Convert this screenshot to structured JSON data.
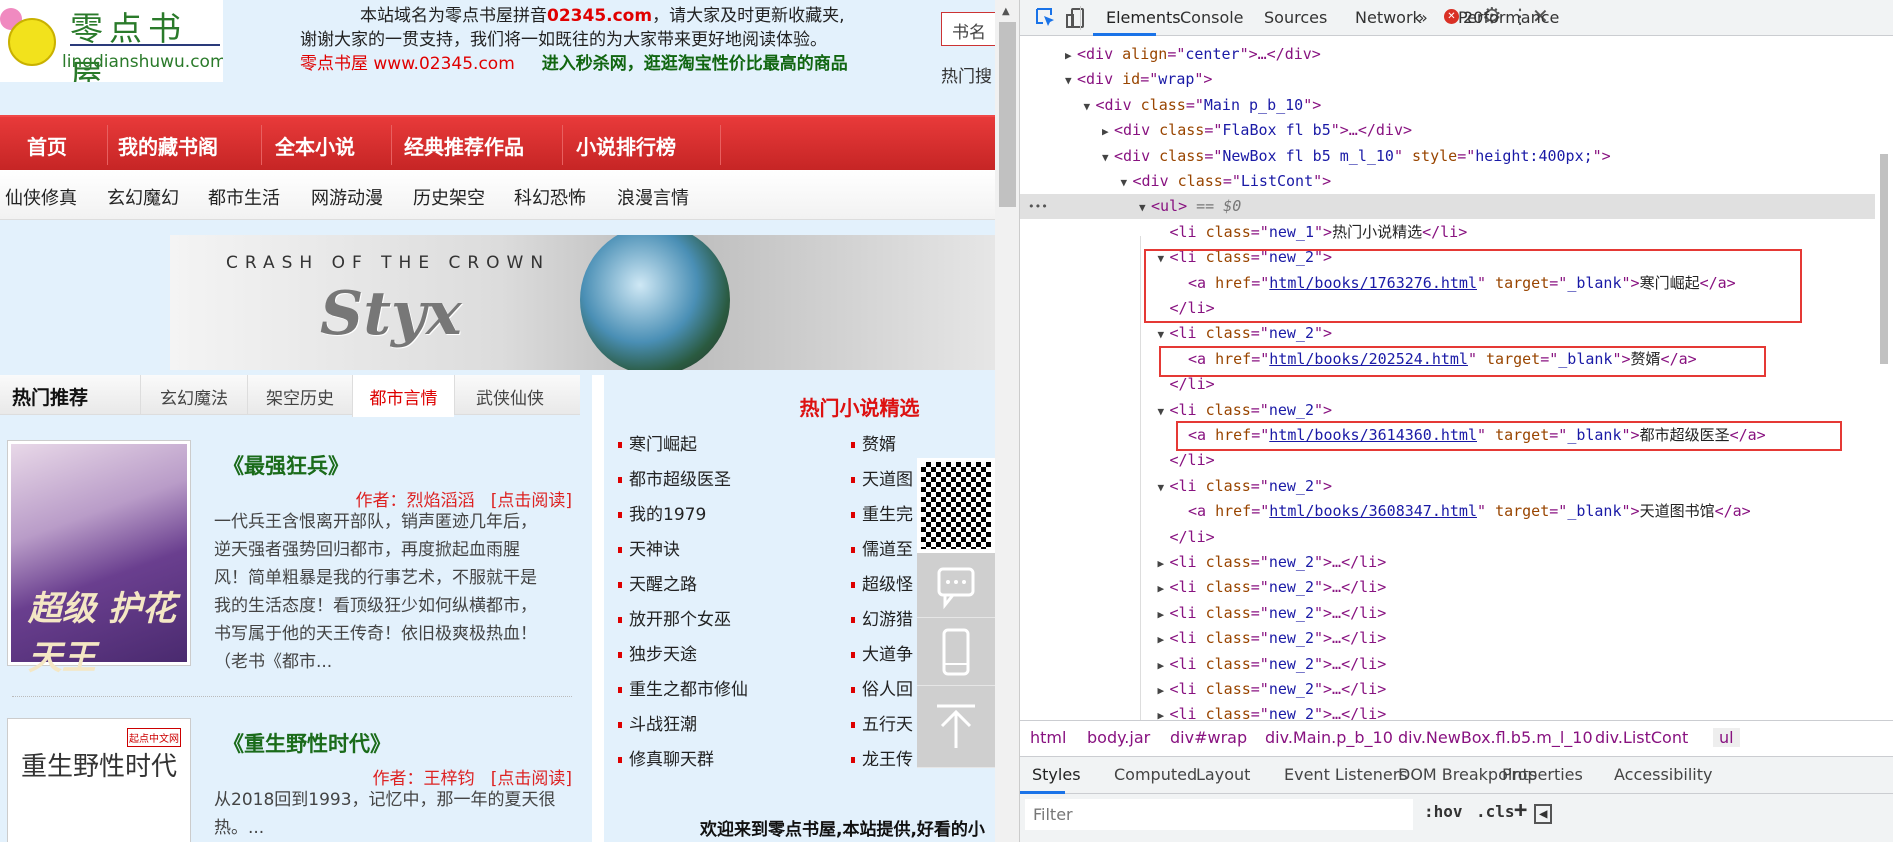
{
  "site": {
    "logo_cn": "零点书屋",
    "logo_en": "lingdianshuwu.com",
    "notice_1a": "本站域名为零点书屋拼音",
    "notice_1b": "02345.com",
    "notice_1c": "，请大家及时更新收藏夹,",
    "notice_2": "谢谢大家的一贯支持，我们将一如既往的为大家带来更好地阅读体验。",
    "notice_3a": "零点书屋 www.02345.com",
    "notice_3b": "进入秒杀网，逛逛淘宝性价比最高的商品",
    "search_placeholder": "书名",
    "hot_search": "热门搜",
    "nav": [
      "首页",
      "我的藏书阁",
      "全本小说",
      "经典推荐作品",
      "小说排行榜"
    ],
    "subnav": [
      "仙侠修真",
      "玄幻魔幻",
      "都市生活",
      "网游动漫",
      "历史架空",
      "科幻恐怖",
      "浪漫言情"
    ],
    "banner_line1": "CRASH OF THE CROWN",
    "banner_line2": "Styx",
    "tabs_head": "热门推荐",
    "tabs": [
      "玄幻魔法",
      "架空历史",
      "都市言情",
      "武侠仙侠"
    ],
    "active_tab": "都市言情",
    "books": [
      {
        "title": "《最强狂兵》",
        "author": "作者：烈焰滔滔",
        "read": "[点击阅读]",
        "cover_text": "超级 护花天王",
        "desc": [
          "一代兵王含恨离开部队，销声匿迹几年后，",
          "逆天强者强势回归都市，再度掀起血雨腥",
          "风！简单粗暴是我的行事艺术，不服就干是",
          "我的生活态度！看顶级狂少如何纵横都市，",
          "书写属于他的天王传奇！依旧极爽极热血！",
          "（老书《都市..."
        ]
      },
      {
        "title": "《重生野性时代》",
        "author": "作者：王梓钧",
        "read": "[点击阅读]",
        "cover_text": "重生野性时代",
        "cover_badge": "起点中文网",
        "desc": [
          "从2018回到1993，记忆中，那一年的夏天很",
          "热。..."
        ]
      }
    ],
    "hot_title": "热门小说精选",
    "hot_col1": [
      "寒门崛起",
      "都市超级医圣",
      "我的1979",
      "天神诀",
      "天醒之路",
      "放开那个女巫",
      "独步天途",
      "重生之都市修仙",
      "斗战狂潮",
      "修真聊天群"
    ],
    "hot_col2": [
      "赘婿",
      "天道图",
      "重生完",
      "儒道至",
      "超级怪",
      "幻游猎",
      "大道争",
      "俗人回",
      "五行天",
      "龙王传"
    ],
    "welcome": "欢迎来到零点书屋,本站提供,好看的小",
    "float_icons": [
      "qr-code",
      "chat-icon",
      "mobile-icon",
      "back-to-top-icon"
    ]
  },
  "devtools": {
    "tabs": [
      "Elements",
      "Console",
      "Sources",
      "Network",
      "Performance"
    ],
    "active_tab": "Elements",
    "more": "»",
    "error_count": "20",
    "tree": [
      {
        "depth": 0,
        "arrow": "right",
        "parts": [
          [
            "tag",
            "<div "
          ],
          [
            "attr",
            "align"
          ],
          [
            "tag",
            "=\""
          ],
          [
            "val",
            "center"
          ],
          [
            "tag",
            "\">…</div>"
          ]
        ]
      },
      {
        "depth": 0,
        "arrow": "down",
        "parts": [
          [
            "tag",
            "<div "
          ],
          [
            "attr",
            "id"
          ],
          [
            "tag",
            "=\""
          ],
          [
            "val",
            "wrap"
          ],
          [
            "tag",
            "\">"
          ]
        ]
      },
      {
        "depth": 1,
        "arrow": "down",
        "parts": [
          [
            "tag",
            "<div "
          ],
          [
            "attr",
            "class"
          ],
          [
            "tag",
            "=\""
          ],
          [
            "val",
            "Main p_b_10"
          ],
          [
            "tag",
            "\">"
          ]
        ]
      },
      {
        "depth": 2,
        "arrow": "right",
        "parts": [
          [
            "tag",
            "<div "
          ],
          [
            "attr",
            "class"
          ],
          [
            "tag",
            "=\""
          ],
          [
            "val",
            "FlaBox fl b5"
          ],
          [
            "tag",
            "\">…</div>"
          ]
        ]
      },
      {
        "depth": 2,
        "arrow": "down",
        "parts": [
          [
            "tag",
            "<div "
          ],
          [
            "attr",
            "class"
          ],
          [
            "tag",
            "=\""
          ],
          [
            "val",
            "NewBox fl b5 m_l_10"
          ],
          [
            "tag",
            "\" "
          ],
          [
            "attr",
            "style"
          ],
          [
            "tag",
            "=\""
          ],
          [
            "val",
            "height:400px;"
          ],
          [
            "tag",
            "\">"
          ]
        ]
      },
      {
        "depth": 3,
        "arrow": "down",
        "parts": [
          [
            "tag",
            "<div "
          ],
          [
            "attr",
            "class"
          ],
          [
            "tag",
            "=\""
          ],
          [
            "val",
            "ListCont"
          ],
          [
            "tag",
            "\">"
          ]
        ]
      },
      {
        "depth": 4,
        "arrow": "down",
        "selected": true,
        "parts": [
          [
            "tag",
            "<ul>"
          ],
          [
            "eq",
            " == $0"
          ]
        ]
      },
      {
        "depth": 5,
        "arrow": "none",
        "parts": [
          [
            "tag",
            "<li "
          ],
          [
            "attr",
            "class"
          ],
          [
            "tag",
            "=\""
          ],
          [
            "val",
            "new_1"
          ],
          [
            "tag",
            "\">"
          ],
          [
            "txt",
            "热门小说精选"
          ],
          [
            "tag",
            "</li>"
          ]
        ]
      },
      {
        "depth": 5,
        "arrow": "down",
        "parts": [
          [
            "tag",
            "<li "
          ],
          [
            "attr",
            "class"
          ],
          [
            "tag",
            "=\""
          ],
          [
            "val",
            "new_2"
          ],
          [
            "tag",
            "\">"
          ]
        ]
      },
      {
        "depth": 6,
        "arrow": "none",
        "parts": [
          [
            "tag",
            "<a "
          ],
          [
            "attr",
            "href"
          ],
          [
            "tag",
            "=\""
          ],
          [
            "link",
            "html/books/1763276.html"
          ],
          [
            "tag",
            "\" "
          ],
          [
            "attr",
            "target"
          ],
          [
            "tag",
            "=\""
          ],
          [
            "val",
            "_blank"
          ],
          [
            "tag",
            "\">"
          ],
          [
            "txt",
            "寒门崛起"
          ],
          [
            "tag",
            "</a>"
          ]
        ]
      },
      {
        "depth": 5,
        "arrow": "none",
        "parts": [
          [
            "tag",
            "</li>"
          ]
        ]
      },
      {
        "depth": 5,
        "arrow": "down",
        "parts": [
          [
            "tag",
            "<li "
          ],
          [
            "attr",
            "class"
          ],
          [
            "tag",
            "=\""
          ],
          [
            "val",
            "new_2"
          ],
          [
            "tag",
            "\">"
          ]
        ]
      },
      {
        "depth": 6,
        "arrow": "none",
        "parts": [
          [
            "tag",
            "<a "
          ],
          [
            "attr",
            "href"
          ],
          [
            "tag",
            "=\""
          ],
          [
            "link",
            "html/books/202524.html"
          ],
          [
            "tag",
            "\" "
          ],
          [
            "attr",
            "target"
          ],
          [
            "tag",
            "=\""
          ],
          [
            "val",
            "_blank"
          ],
          [
            "tag",
            "\">"
          ],
          [
            "txt",
            "赘婿"
          ],
          [
            "tag",
            "</a>"
          ]
        ]
      },
      {
        "depth": 5,
        "arrow": "none",
        "parts": [
          [
            "tag",
            "</li>"
          ]
        ]
      },
      {
        "depth": 5,
        "arrow": "down",
        "parts": [
          [
            "tag",
            "<li "
          ],
          [
            "attr",
            "class"
          ],
          [
            "tag",
            "=\""
          ],
          [
            "val",
            "new_2"
          ],
          [
            "tag",
            "\">"
          ]
        ]
      },
      {
        "depth": 6,
        "arrow": "none",
        "parts": [
          [
            "tag",
            "<a "
          ],
          [
            "attr",
            "href"
          ],
          [
            "tag",
            "=\""
          ],
          [
            "link",
            "html/books/3614360.html"
          ],
          [
            "tag",
            "\" "
          ],
          [
            "attr",
            "target"
          ],
          [
            "tag",
            "=\""
          ],
          [
            "val",
            "_blank"
          ],
          [
            "tag",
            "\">"
          ],
          [
            "txt",
            "都市超级医圣"
          ],
          [
            "tag",
            "</a>"
          ]
        ]
      },
      {
        "depth": 5,
        "arrow": "none",
        "parts": [
          [
            "tag",
            "</li>"
          ]
        ]
      },
      {
        "depth": 5,
        "arrow": "down",
        "parts": [
          [
            "tag",
            "<li "
          ],
          [
            "attr",
            "class"
          ],
          [
            "tag",
            "=\""
          ],
          [
            "val",
            "new_2"
          ],
          [
            "tag",
            "\">"
          ]
        ]
      },
      {
        "depth": 6,
        "arrow": "none",
        "parts": [
          [
            "tag",
            "<a "
          ],
          [
            "attr",
            "href"
          ],
          [
            "tag",
            "=\""
          ],
          [
            "link",
            "html/books/3608347.html"
          ],
          [
            "tag",
            "\" "
          ],
          [
            "attr",
            "target"
          ],
          [
            "tag",
            "=\""
          ],
          [
            "val",
            "_blank"
          ],
          [
            "tag",
            "\">"
          ],
          [
            "txt",
            "天道图书馆"
          ],
          [
            "tag",
            "</a>"
          ]
        ]
      },
      {
        "depth": 5,
        "arrow": "none",
        "parts": [
          [
            "tag",
            "</li>"
          ]
        ]
      },
      {
        "depth": 5,
        "arrow": "right",
        "parts": [
          [
            "tag",
            "<li "
          ],
          [
            "attr",
            "class"
          ],
          [
            "tag",
            "=\""
          ],
          [
            "val",
            "new_2"
          ],
          [
            "tag",
            "\">…</li>"
          ]
        ]
      },
      {
        "depth": 5,
        "arrow": "right",
        "parts": [
          [
            "tag",
            "<li "
          ],
          [
            "attr",
            "class"
          ],
          [
            "tag",
            "=\""
          ],
          [
            "val",
            "new_2"
          ],
          [
            "tag",
            "\">…</li>"
          ]
        ]
      },
      {
        "depth": 5,
        "arrow": "right",
        "parts": [
          [
            "tag",
            "<li "
          ],
          [
            "attr",
            "class"
          ],
          [
            "tag",
            "=\""
          ],
          [
            "val",
            "new_2"
          ],
          [
            "tag",
            "\">…</li>"
          ]
        ]
      },
      {
        "depth": 5,
        "arrow": "right",
        "parts": [
          [
            "tag",
            "<li "
          ],
          [
            "attr",
            "class"
          ],
          [
            "tag",
            "=\""
          ],
          [
            "val",
            "new_2"
          ],
          [
            "tag",
            "\">…</li>"
          ]
        ]
      },
      {
        "depth": 5,
        "arrow": "right",
        "parts": [
          [
            "tag",
            "<li "
          ],
          [
            "attr",
            "class"
          ],
          [
            "tag",
            "=\""
          ],
          [
            "val",
            "new_2"
          ],
          [
            "tag",
            "\">…</li>"
          ]
        ]
      },
      {
        "depth": 5,
        "arrow": "right",
        "parts": [
          [
            "tag",
            "<li "
          ],
          [
            "attr",
            "class"
          ],
          [
            "tag",
            "=\""
          ],
          [
            "val",
            "new_2"
          ],
          [
            "tag",
            "\">…</li>"
          ]
        ]
      },
      {
        "depth": 5,
        "arrow": "right",
        "parts": [
          [
            "tag",
            "<li "
          ],
          [
            "attr",
            "class"
          ],
          [
            "tag",
            "=\""
          ],
          [
            "val",
            "new_2"
          ],
          [
            "tag",
            "\">…</li>"
          ]
        ]
      }
    ],
    "breadcrumbs": [
      "html",
      "body.jar",
      "div#wrap",
      "div.Main.p_b_10",
      "div.NewBox.fl.b5.m_l_10",
      "div.ListCont",
      "ul"
    ],
    "panel_tabs": [
      "Styles",
      "Computed",
      "Layout",
      "Event Listeners",
      "DOM Breakpoints",
      "Properties",
      "Accessibility"
    ],
    "filter_placeholder": "Filter",
    "hov": ":hov",
    "cls": ".cls",
    "plus": "+",
    "highlight_color": "#e53935"
  }
}
